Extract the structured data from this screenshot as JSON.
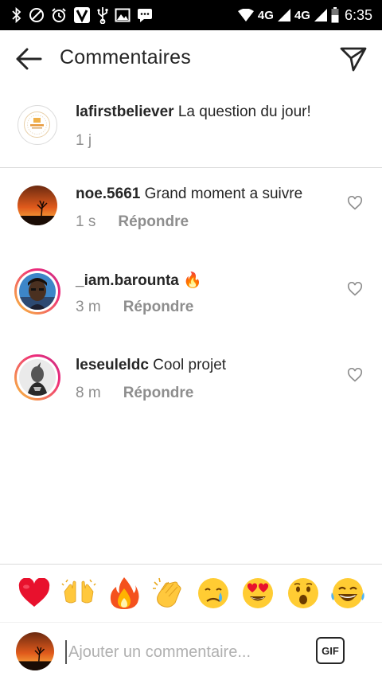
{
  "status_bar": {
    "network_1": "4G",
    "network_2": "4G",
    "time": "6:35"
  },
  "header": {
    "title": "Commentaires",
    "back_icon": "arrow-left-icon",
    "send_icon": "paper-plane-icon"
  },
  "caption": {
    "username": "lafirstbeliever",
    "text": "La question du jour!",
    "time": "1 j"
  },
  "comments": [
    {
      "username": "noe.5661",
      "text": "Grand moment a suivre",
      "time": "1 s",
      "reply_label": "Répondre"
    },
    {
      "username": "_iam.barounta",
      "text": "🔥",
      "time": "3 m",
      "reply_label": "Répondre"
    },
    {
      "username": "leseuleldc",
      "text": "Cool projet",
      "time": "8 m",
      "reply_label": "Répondre"
    }
  ],
  "emoji_bar": [
    "❤️",
    "🙌",
    "🔥",
    "👏",
    "😢",
    "😍",
    "😮",
    "😂"
  ],
  "composer": {
    "placeholder": "Ajouter un commentaire...",
    "gif_label": "GIF"
  }
}
